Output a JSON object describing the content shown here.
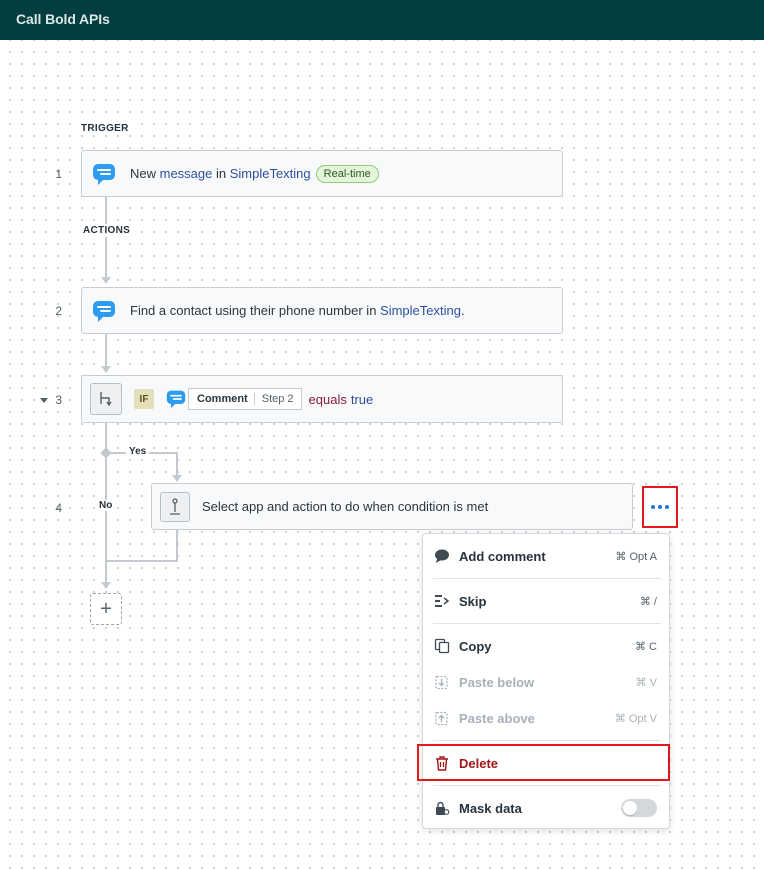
{
  "title": "Call Bold APIs",
  "sections": {
    "trigger": "TRIGGER",
    "actions": "ACTIONS"
  },
  "steps": [
    {
      "num": "1",
      "text_pre": "New ",
      "link1": "message",
      "text_mid": " in ",
      "link2": "SimpleTexting",
      "badge": "Real-time"
    },
    {
      "num": "2",
      "text_pre": "Find a contact using their phone number in ",
      "link": "SimpleTexting",
      "text_post": "."
    },
    {
      "num": "3",
      "if_label": "IF",
      "field_name": "Comment",
      "field_step": "Step 2",
      "operator": "equals",
      "value": "true"
    },
    {
      "num": "4",
      "text": "Select app and action to do when condition is met"
    }
  ],
  "branches": {
    "yes": "Yes",
    "no": "No"
  },
  "add_symbol": "+",
  "menu": {
    "items": [
      {
        "label": "Add comment",
        "shortcut": "⌘ Opt A",
        "icon": "comment-icon"
      },
      {
        "label": "Skip",
        "shortcut": "⌘ /",
        "icon": "skip-icon"
      },
      {
        "label": "Copy",
        "shortcut": "⌘ C",
        "icon": "copy-icon"
      },
      {
        "label": "Paste below",
        "shortcut": "⌘ V",
        "icon": "paste-below-icon",
        "disabled": true
      },
      {
        "label": "Paste above",
        "shortcut": "⌘ Opt V",
        "icon": "paste-above-icon",
        "disabled": true
      },
      {
        "label": "Delete",
        "shortcut": "",
        "icon": "trash-icon"
      },
      {
        "label": "Mask data",
        "shortcut": "",
        "icon": "lock-icon"
      }
    ],
    "mask_toggle_on": false
  },
  "colors": {
    "header": "#033d3f",
    "danger": "#a0161b",
    "highlight": "#e0191d",
    "link": "#2d4f9e"
  }
}
